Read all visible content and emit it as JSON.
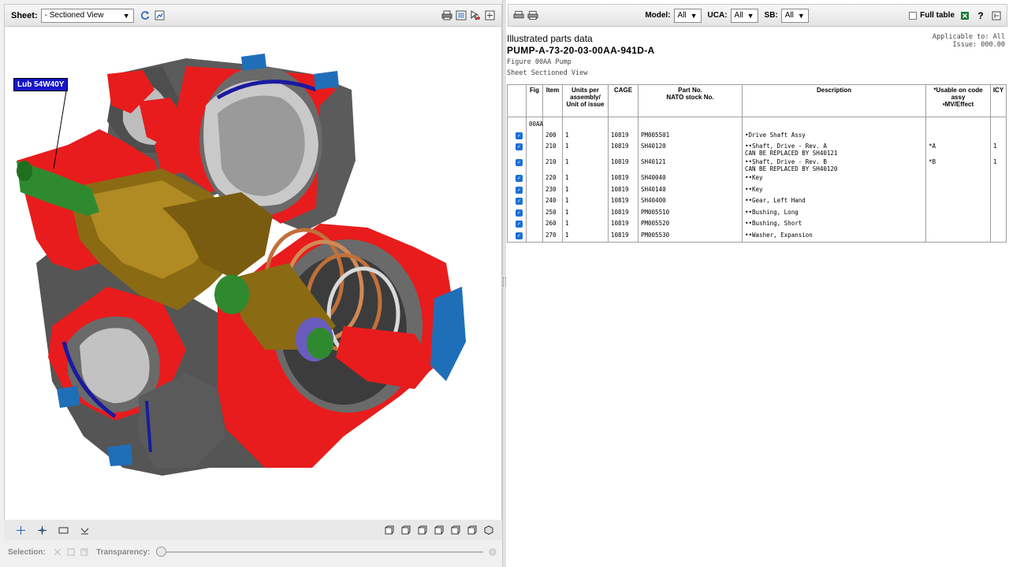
{
  "left_toolbar": {
    "sheet_label": "Sheet:",
    "sheet_value": "- Sectioned View"
  },
  "viewer": {
    "callout_label": "Lub 54W40Y"
  },
  "selection_bar": {
    "selection_label": "Selection:",
    "transparency_label": "Transparency:",
    "transparency_value": 0
  },
  "right_toolbar": {
    "model_label": "Model:",
    "model_value": "All",
    "uca_label": "UCA:",
    "uca_value": "All",
    "sb_label": "SB:",
    "sb_value": "All",
    "full_table_label": "Full table"
  },
  "ipd": {
    "title": "Illustrated parts data",
    "dmc": "PUMP-A-73-20-03-00AA-941D-A",
    "figure_line": "Figure 00AA    Pump",
    "sheet_line": "Sheet Sectioned View",
    "applicable": "Applicable to: All",
    "issue": "Issue: 000.00"
  },
  "table": {
    "headers": [
      "",
      "Fig",
      "Item",
      "Units per assembly/ Unit of issue",
      "CAGE",
      "Part No.\nNATO stock No.",
      "Description",
      "*Usable on code assy\n•MV/Effect",
      "ICY"
    ],
    "fig_value": "00AA",
    "rows": [
      {
        "item": "200",
        "units": "1",
        "cage": "10819",
        "part": "PM005501",
        "desc": "•Drive Shaft Assy",
        "usable": "",
        "icy": ""
      },
      {
        "item": "210",
        "units": "1",
        "cage": "10819",
        "part": "SH40120",
        "desc": "••Shaft, Drive - Rev. A\n  CAN BE REPLACED BY SH40121",
        "usable": "*A",
        "icy": "1"
      },
      {
        "item": "210",
        "units": "1",
        "cage": "10819",
        "part": "SH40121",
        "desc": "••Shaft, Drive - Rev. B\n  CAN BE REPLACED BY SH40120",
        "usable": "*B",
        "icy": "1"
      },
      {
        "item": "220",
        "units": "1",
        "cage": "10819",
        "part": "SH40040",
        "desc": "••Key",
        "usable": "",
        "icy": ""
      },
      {
        "item": "230",
        "units": "1",
        "cage": "10819",
        "part": "SH40140",
        "desc": "••Key",
        "usable": "",
        "icy": ""
      },
      {
        "item": "240",
        "units": "1",
        "cage": "10819",
        "part": "SH40400",
        "desc": "••Gear, Left Hand",
        "usable": "",
        "icy": ""
      },
      {
        "item": "250",
        "units": "1",
        "cage": "10819",
        "part": "PM005510",
        "desc": "••Bushing, Long",
        "usable": "",
        "icy": ""
      },
      {
        "item": "260",
        "units": "1",
        "cage": "10819",
        "part": "PM005520",
        "desc": "••Bushing, Short",
        "usable": "",
        "icy": ""
      },
      {
        "item": "270",
        "units": "1",
        "cage": "10819",
        "part": "PM005530",
        "desc": "••Washer, Expansion",
        "usable": "",
        "icy": ""
      }
    ]
  },
  "colors": {
    "section_red": "#e81c1c",
    "body_gray": "#5a5a5a",
    "bronze": "#8a6a12",
    "green": "#2f8a2f",
    "bolt_blue": "#1f6fb8",
    "copper": "#c0703a",
    "callout_blue": "#1414c8",
    "checkbox_blue": "#1a6fd6"
  }
}
